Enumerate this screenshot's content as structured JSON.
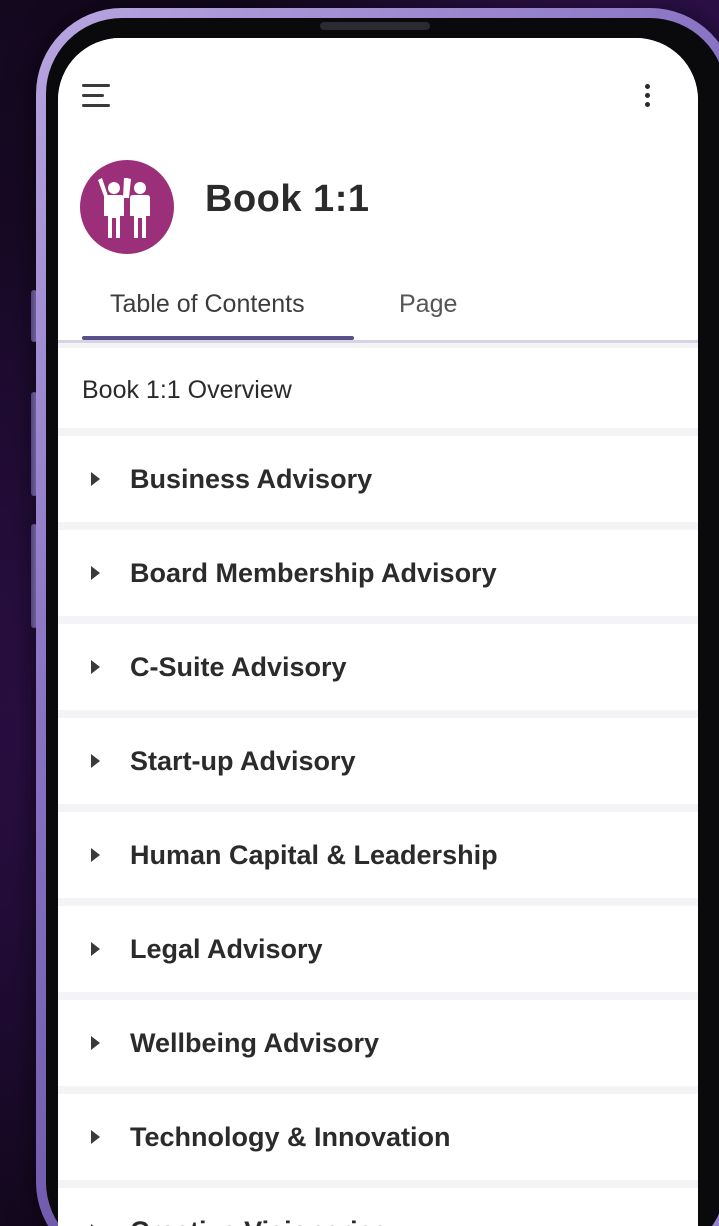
{
  "app": {
    "title": "Book 1:1",
    "accent_color": "#9b2f7a",
    "tab_indicator_color": "#5a4f8a"
  },
  "header": {
    "menu_icon": "hamburger-menu-icon",
    "more_icon": "vertical-dots-icon",
    "avatar_icon": "high-five-people-icon"
  },
  "tabs": [
    {
      "label": "Table of Contents",
      "active": true
    },
    {
      "label": "Page",
      "active": false
    }
  ],
  "overview": {
    "label": "Book 1:1 Overview"
  },
  "toc_items": [
    {
      "label": "Business Advisory"
    },
    {
      "label": "Board Membership Advisory"
    },
    {
      "label": "C-Suite Advisory"
    },
    {
      "label": "Start-up Advisory"
    },
    {
      "label": "Human Capital & Leadership"
    },
    {
      "label": "Legal Advisory"
    },
    {
      "label": "Wellbeing Advisory"
    },
    {
      "label": "Technology & Innovation"
    },
    {
      "label": "Creative Visionaries"
    }
  ]
}
